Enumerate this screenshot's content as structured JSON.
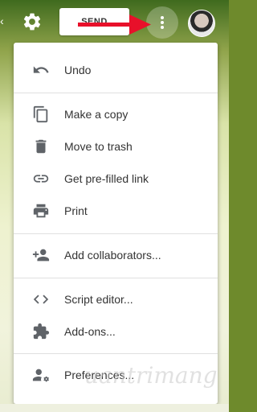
{
  "toolbar": {
    "send_label": "SEND"
  },
  "menu": {
    "items": [
      {
        "label": "Undo",
        "icon": "undo-icon"
      },
      {
        "label": "Make a copy",
        "icon": "copy-icon"
      },
      {
        "label": "Move to trash",
        "icon": "trash-icon"
      },
      {
        "label": "Get pre-filled link",
        "icon": "link-icon"
      },
      {
        "label": "Print",
        "icon": "print-icon"
      },
      {
        "label": "Add collaborators...",
        "icon": "add-people-icon"
      },
      {
        "label": "Script editor...",
        "icon": "code-icon"
      },
      {
        "label": "Add-ons...",
        "icon": "puzzle-icon"
      },
      {
        "label": "Preferences...",
        "icon": "people-settings-icon"
      }
    ]
  },
  "watermark": {
    "text": "uantrimang"
  },
  "colors": {
    "arrow": "#e8102a",
    "icon": "#5f6368",
    "text": "#333333"
  }
}
